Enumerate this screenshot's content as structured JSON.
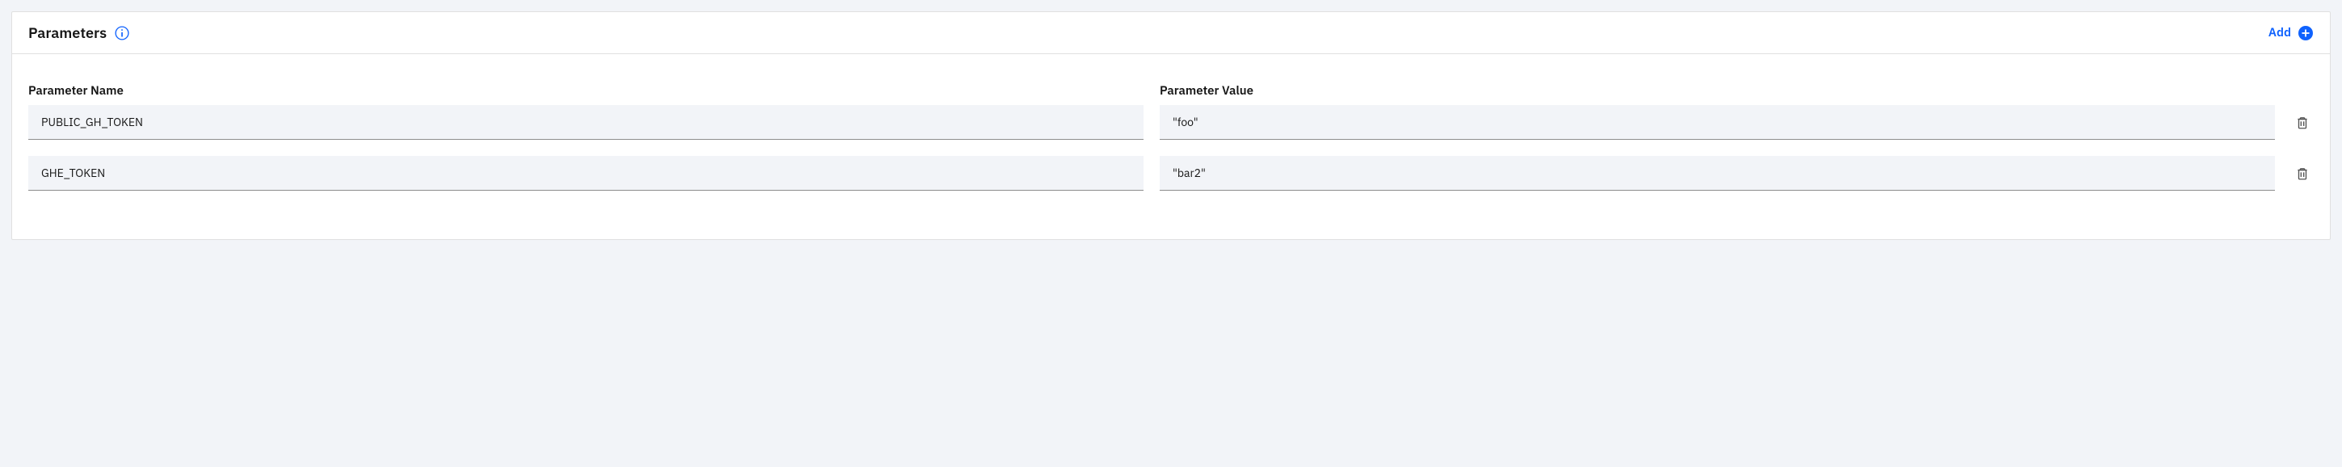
{
  "panel": {
    "title": "Parameters",
    "add_label": "Add",
    "columns": {
      "name": "Parameter Name",
      "value": "Parameter Value"
    },
    "rows": [
      {
        "name": "PUBLIC_GH_TOKEN",
        "value": "\"foo\""
      },
      {
        "name": "GHE_TOKEN",
        "value": "\"bar2\""
      }
    ]
  }
}
